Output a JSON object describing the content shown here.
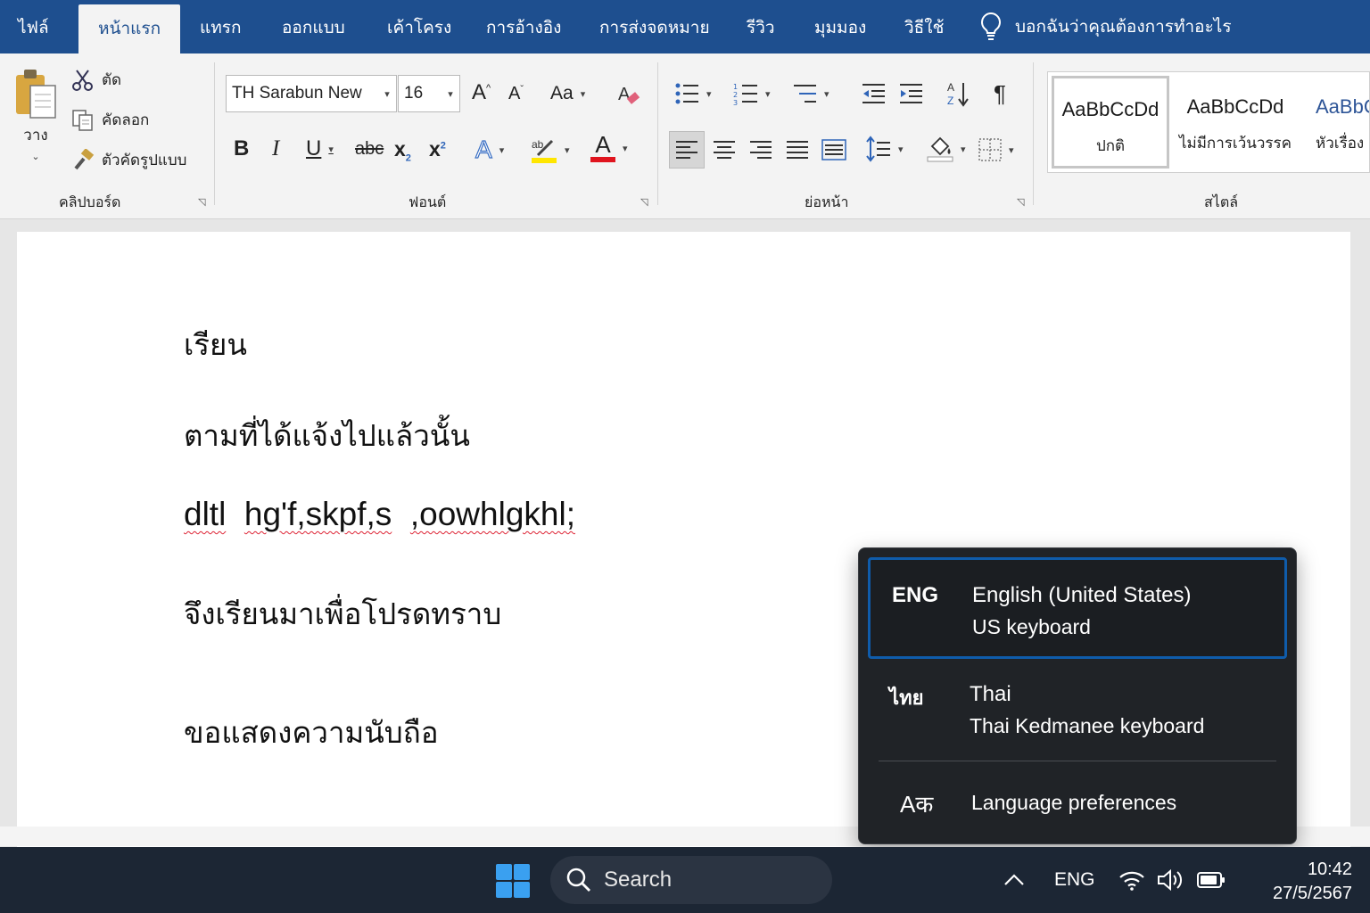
{
  "tabs": [
    "ไฟล์",
    "หน้าแรก",
    "แทรก",
    "ออกแบบ",
    "เค้าโครง",
    "การอ้างอิง",
    "การส่งจดหมาย",
    "รีวิว",
    "มุมมอง",
    "วิธีใช้"
  ],
  "tell_me": "บอกฉันว่าคุณต้องการทำอะไร",
  "clipboard": {
    "paste": "วาง",
    "cut": "ตัด",
    "copy": "คัดลอก",
    "format_painter": "ตัวคัดรูปแบบ",
    "label": "คลิปบอร์ด"
  },
  "font": {
    "name": "TH Sarabun New",
    "size": "16",
    "change_case": "Aa",
    "label": "ฟอนต์",
    "highlight_color": "#ffe600",
    "font_color": "#e0141e"
  },
  "paragraph": {
    "label": "ย่อหน้า"
  },
  "styles": {
    "label": "สไตล์",
    "items": [
      {
        "sample": "AaBbCcDd",
        "name": "ปกติ"
      },
      {
        "sample": "AaBbCcDd",
        "name": "ไม่มีการเว้นวรรค"
      },
      {
        "sample": "AaBbC",
        "name": "หัวเรื่อง"
      }
    ]
  },
  "document": {
    "line1": "เรียน",
    "line2": "ตามที่ได้แจ้งไปแล้วนั้น",
    "line3_words": [
      "dltl",
      "hg'f,skpf,s",
      ",oowhlgkhl;"
    ],
    "line4": "จึงเรียนมาเพื่อโปรดทราบ",
    "line5": "ขอแสดงความนับถือ"
  },
  "language_flyout": {
    "items": [
      {
        "code": "ENG",
        "name": "English (United States)",
        "keyboard": "US keyboard"
      },
      {
        "code": "ไทย",
        "name": "Thai",
        "keyboard": "Thai Kedmanee keyboard"
      }
    ],
    "preferences_icon": "Aक",
    "preferences": "Language preferences",
    "accent": "#0f5cab"
  },
  "taskbar": {
    "search": "Search",
    "input_indicator": "ENG",
    "time": "10:42",
    "date": "27/5/2567"
  },
  "colors": {
    "title_blue": "#1e4f8f",
    "taskbar": "#1c2634",
    "flyout_bg": "#202327"
  }
}
